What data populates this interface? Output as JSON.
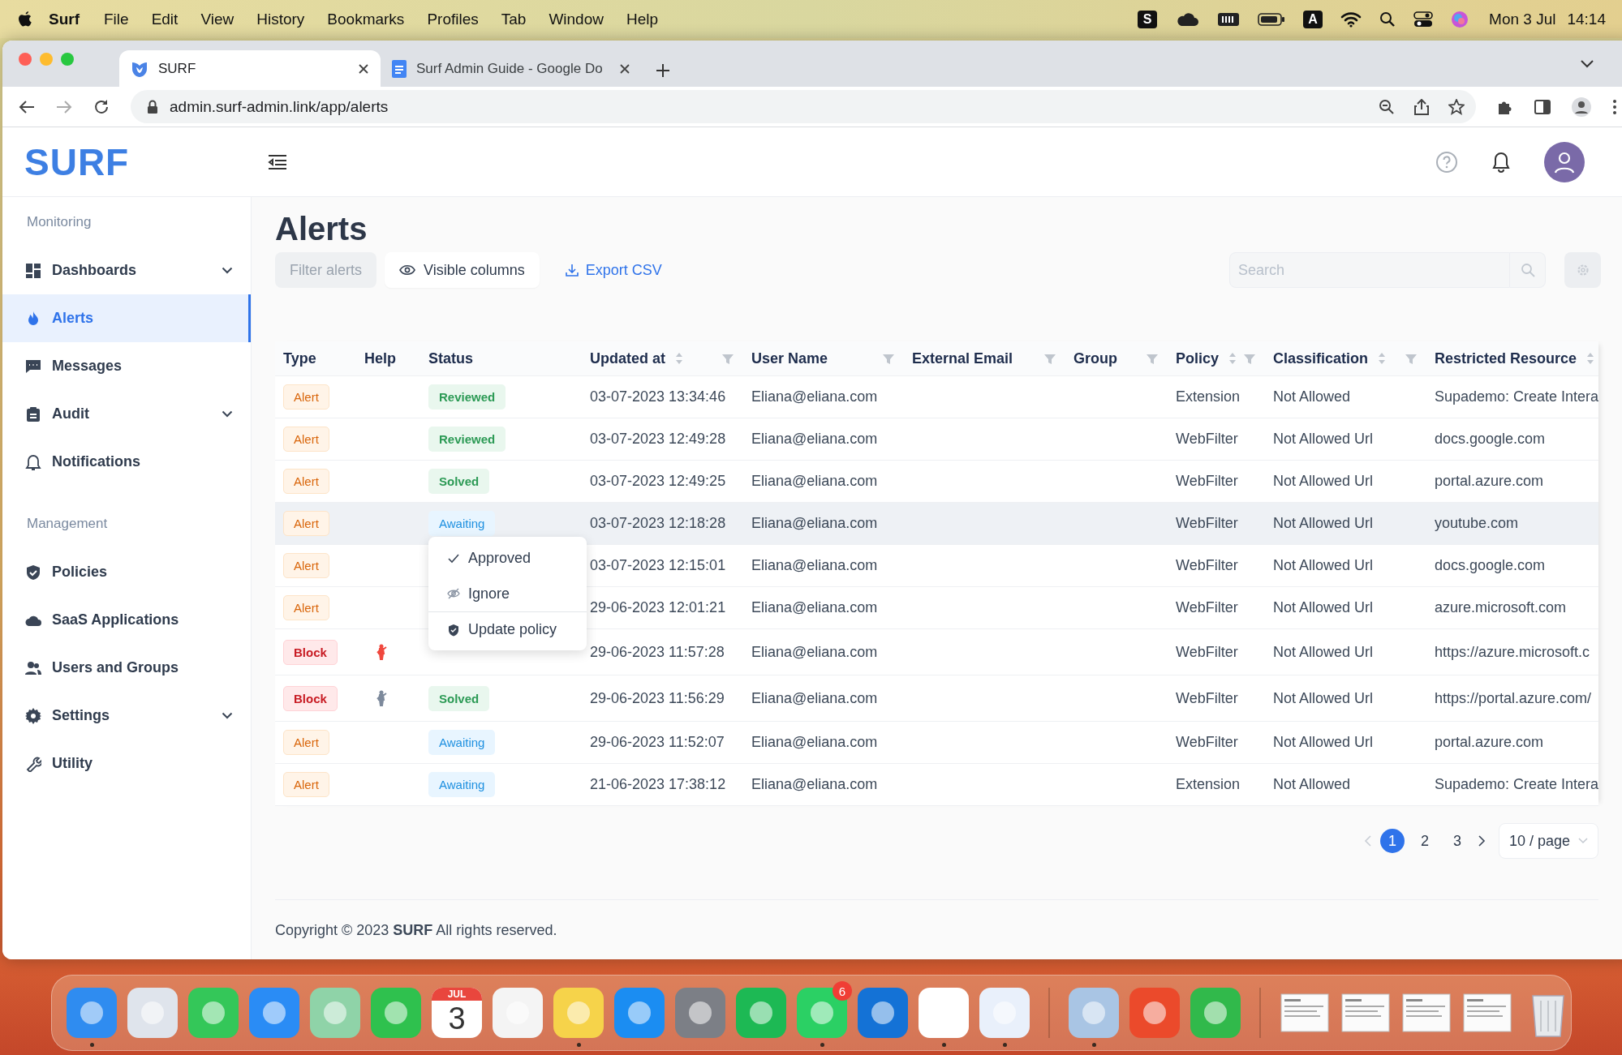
{
  "menu_bar": {
    "app": "Surf",
    "menus": [
      "File",
      "Edit",
      "View",
      "History",
      "Bookmarks",
      "Profiles",
      "Tab",
      "Window",
      "Help"
    ],
    "status_items": [
      {
        "kind": "letter",
        "text": "S"
      },
      {
        "kind": "icon"
      },
      {
        "kind": "icon"
      },
      {
        "kind": "icon"
      },
      {
        "kind": "letter",
        "text": "A"
      },
      {
        "kind": "icon"
      },
      {
        "kind": "icon"
      },
      {
        "kind": "icon"
      },
      {
        "kind": "icon"
      }
    ],
    "date": "Mon 3 Jul",
    "time": "14:14"
  },
  "browser": {
    "tabs": [
      {
        "title": "SURF",
        "selected": true
      },
      {
        "title": "Surf Admin Guide - Google Do",
        "selected": false
      }
    ],
    "url": "admin.surf-admin.link/app/alerts"
  },
  "app": {
    "logo": "SURF"
  },
  "sidebar": {
    "sections": [
      {
        "label": "Monitoring",
        "items": [
          {
            "label": "Dashboards",
            "expandable": true,
            "selected": false
          },
          {
            "label": "Alerts",
            "expandable": false,
            "selected": true
          },
          {
            "label": "Messages",
            "expandable": false,
            "selected": false
          },
          {
            "label": "Audit",
            "expandable": true,
            "selected": false
          },
          {
            "label": "Notifications",
            "expandable": false,
            "selected": false
          }
        ]
      },
      {
        "label": "Management",
        "items": [
          {
            "label": "Policies",
            "expandable": false,
            "selected": false
          },
          {
            "label": "SaaS Applications",
            "expandable": false,
            "selected": false
          },
          {
            "label": "Users and Groups",
            "expandable": false,
            "selected": false
          },
          {
            "label": "Settings",
            "expandable": true,
            "selected": false
          },
          {
            "label": "Utility",
            "expandable": false,
            "selected": false
          }
        ]
      }
    ]
  },
  "page": {
    "title": "Alerts",
    "filter_button": {
      "label": "Filter alerts",
      "disabled": true
    },
    "columns_button": "Visible columns",
    "export_link": "Export CSV",
    "search": {
      "placeholder": "Search"
    },
    "settings_disabled": true
  },
  "table": {
    "columns": [
      {
        "label": "Type",
        "sortable": false,
        "filterable": false
      },
      {
        "label": "Help",
        "sortable": false,
        "filterable": false
      },
      {
        "label": "Status",
        "sortable": false,
        "filterable": false
      },
      {
        "label": "Updated at",
        "sortable": true,
        "filterable": true
      },
      {
        "label": "User Name",
        "sortable": false,
        "filterable": true
      },
      {
        "label": "External Email",
        "sortable": false,
        "filterable": true
      },
      {
        "label": "Group",
        "sortable": false,
        "filterable": true
      },
      {
        "label": "Policy",
        "sortable": true,
        "filterable": true
      },
      {
        "label": "Classification",
        "sortable": true,
        "filterable": true
      },
      {
        "label": "Restricted Resource",
        "sortable": true,
        "filterable": false
      }
    ],
    "rows": [
      {
        "type": {
          "label": "Alert",
          "kind": "alert"
        },
        "status": {
          "label": "Reviewed",
          "kind": "done"
        },
        "updated_at": "03-07-2023 13:34:46",
        "user_name": "Eliana@eliana.com",
        "policy": "Extension",
        "classification": "Not Allowed",
        "restricted_resource": "Supademo: Create Intera",
        "highlighted": false
      },
      {
        "type": {
          "label": "Alert",
          "kind": "alert"
        },
        "status": {
          "label": "Reviewed",
          "kind": "done"
        },
        "updated_at": "03-07-2023 12:49:28",
        "user_name": "Eliana@eliana.com",
        "policy": "WebFilter",
        "classification": "Not Allowed Url",
        "restricted_resource": "docs.google.com",
        "highlighted": false
      },
      {
        "type": {
          "label": "Alert",
          "kind": "alert"
        },
        "status": {
          "label": "Solved",
          "kind": "done"
        },
        "updated_at": "03-07-2023 12:49:25",
        "user_name": "Eliana@eliana.com",
        "policy": "WebFilter",
        "classification": "Not Allowed Url",
        "restricted_resource": "portal.azure.com",
        "highlighted": false
      },
      {
        "type": {
          "label": "Alert",
          "kind": "alert"
        },
        "status": {
          "label": "Awaiting",
          "kind": "awaiting"
        },
        "updated_at": "03-07-2023 12:18:28",
        "user_name": "Eliana@eliana.com",
        "policy": "WebFilter",
        "classification": "Not Allowed Url",
        "restricted_resource": "youtube.com",
        "highlighted": true
      },
      {
        "type": {
          "label": "Alert",
          "kind": "alert"
        },
        "updated_at": "03-07-2023 12:15:01",
        "user_name": "Eliana@eliana.com",
        "policy": "WebFilter",
        "classification": "Not Allowed Url",
        "restricted_resource": "docs.google.com",
        "highlighted": false
      },
      {
        "type": {
          "label": "Alert",
          "kind": "alert"
        },
        "updated_at": "29-06-2023 12:01:21",
        "user_name": "Eliana@eliana.com",
        "policy": "WebFilter",
        "classification": "Not Allowed Url",
        "restricted_resource": "azure.microsoft.com",
        "highlighted": false
      },
      {
        "type": {
          "label": "Block",
          "kind": "block"
        },
        "help": {
          "color": "#f0483e"
        },
        "updated_at": "29-06-2023 11:57:28",
        "user_name": "Eliana@eliana.com",
        "policy": "WebFilter",
        "classification": "Not Allowed Url",
        "restricted_resource": "https://azure.microsoft.c",
        "highlighted": false
      },
      {
        "type": {
          "label": "Block",
          "kind": "block"
        },
        "help": {
          "color": "#7d8a9c"
        },
        "status": {
          "label": "Solved",
          "kind": "done"
        },
        "updated_at": "29-06-2023 11:56:29",
        "user_name": "Eliana@eliana.com",
        "policy": "WebFilter",
        "classification": "Not Allowed Url",
        "restricted_resource": "https://portal.azure.com/",
        "highlighted": false
      },
      {
        "type": {
          "label": "Alert",
          "kind": "alert"
        },
        "status": {
          "label": "Awaiting",
          "kind": "awaiting"
        },
        "updated_at": "29-06-2023 11:52:07",
        "user_name": "Eliana@eliana.com",
        "policy": "WebFilter",
        "classification": "Not Allowed Url",
        "restricted_resource": "portal.azure.com",
        "highlighted": false
      },
      {
        "type": {
          "label": "Alert",
          "kind": "alert"
        },
        "status": {
          "label": "Awaiting",
          "kind": "awaiting"
        },
        "updated_at": "21-06-2023 17:38:12",
        "user_name": "Eliana@eliana.com",
        "policy": "Extension",
        "classification": "Not Allowed",
        "restricted_resource": "Supademo: Create Intera",
        "highlighted": false
      }
    ]
  },
  "status_menu": {
    "items": [
      {
        "label": "Approved",
        "divider_before": false
      },
      {
        "label": "Ignore",
        "divider_before": false
      },
      {
        "label": "Update policy",
        "divider_before": true
      }
    ]
  },
  "pagination": {
    "prev_disabled": true,
    "pages": [
      {
        "label": "1",
        "selected": true
      },
      {
        "label": "2",
        "selected": false
      },
      {
        "label": "3",
        "selected": false
      }
    ],
    "page_size": "10 / page"
  },
  "footer": "Copyright © 2023 **SURF** All rights reserved.",
  "dock": {
    "items": [
      {
        "kind": "app",
        "color": "#2f8cf0",
        "running": true
      },
      {
        "kind": "app",
        "color": "#dfe4ec",
        "running": false
      },
      {
        "kind": "app",
        "color": "#34c759",
        "running": false
      },
      {
        "kind": "app",
        "color": "#2a8cf5",
        "running": false
      },
      {
        "kind": "app",
        "color": "#8fd3a8",
        "running": false
      },
      {
        "kind": "app",
        "color": "#2fc14e",
        "running": false
      },
      {
        "kind": "calendar",
        "month": "JUL",
        "day": "3",
        "running": false
      },
      {
        "kind": "app",
        "color": "#f4f4f4",
        "running": false
      },
      {
        "kind": "app",
        "color": "#f6d34a",
        "running": true
      },
      {
        "kind": "app",
        "color": "#1b8df2",
        "running": false
      },
      {
        "kind": "app",
        "color": "#7c7f86",
        "running": false
      },
      {
        "kind": "app",
        "color": "#1db954",
        "running": false
      },
      {
        "kind": "app",
        "color": "#2bd064",
        "running": true,
        "badge": "6"
      },
      {
        "kind": "app",
        "color": "#1472d6",
        "running": false
      },
      {
        "kind": "app",
        "color": "#ffffff",
        "running": true
      },
      {
        "kind": "app",
        "color": "#e9f0fb",
        "running": true
      },
      {
        "kind": "separator"
      },
      {
        "kind": "app",
        "color": "#a9c5e4",
        "running": true
      },
      {
        "kind": "app",
        "color": "#eb4a2b",
        "running": false
      },
      {
        "kind": "app",
        "color": "#31b94b",
        "running": false
      },
      {
        "kind": "separator"
      },
      {
        "kind": "thumbnail"
      },
      {
        "kind": "thumbnail"
      },
      {
        "kind": "thumbnail"
      },
      {
        "kind": "thumbnail"
      },
      {
        "kind": "trash"
      }
    ]
  }
}
